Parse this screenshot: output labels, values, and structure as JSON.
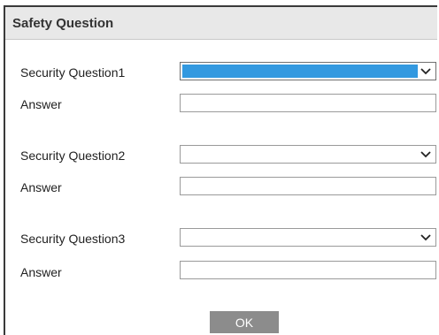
{
  "dialog": {
    "title": "Safety Question",
    "ok_label": "OK"
  },
  "questions": [
    {
      "label": "Security Question1",
      "answer_label": "Answer",
      "selected": "",
      "answer_value": ""
    },
    {
      "label": "Security Question2",
      "answer_label": "Answer",
      "selected": "",
      "answer_value": ""
    },
    {
      "label": "Security Question3",
      "answer_label": "Answer",
      "selected": "",
      "answer_value": ""
    }
  ],
  "colors": {
    "selection_highlight": "#3399e0",
    "ok_button_bg": "#8c8c8c",
    "header_bg": "#e8e8e8"
  },
  "icons": {
    "dropdown": "chevron-down-icon"
  }
}
